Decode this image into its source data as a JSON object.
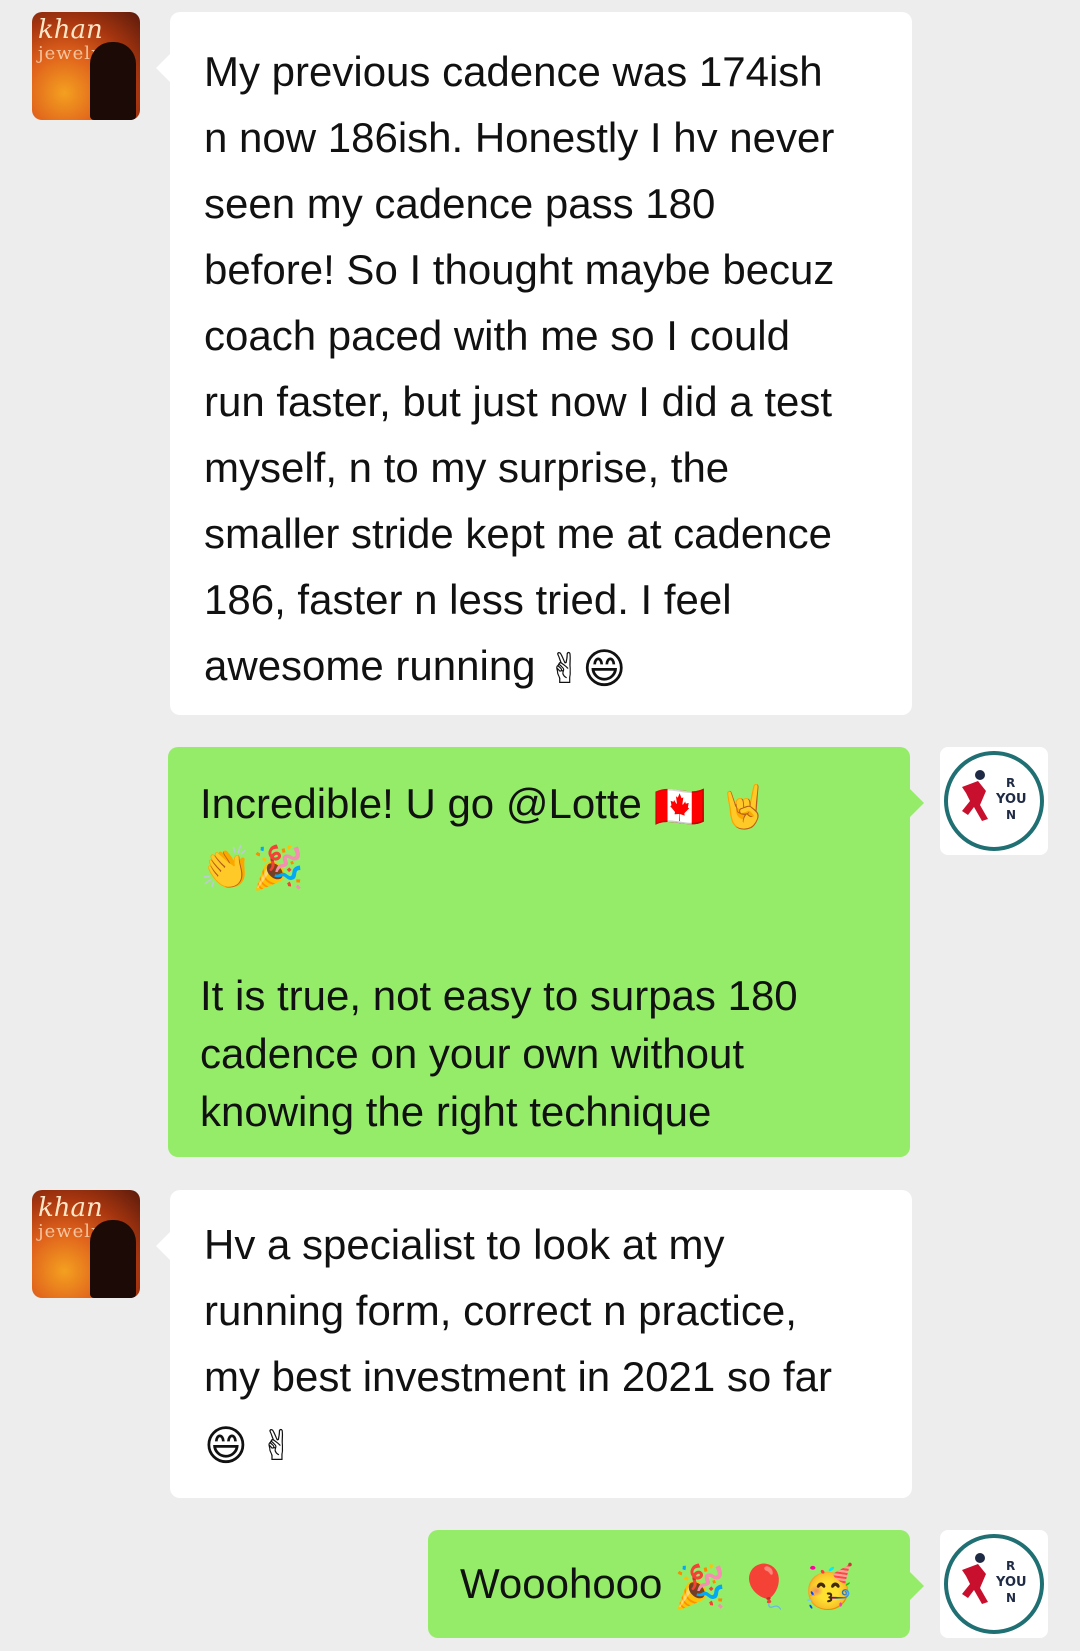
{
  "messages": [
    {
      "sender": "them",
      "avatar": {
        "brand_line1": "khan",
        "brand_line2": "jewelry"
      },
      "lines": [
        "My previous cadence was 174ish",
        "n now 186ish. Honestly I hv never",
        "seen my cadence pass 180",
        "before! So I thought maybe becuz",
        "coach paced with me so I could",
        "run faster, but just now I did a test",
        "myself, n to my surprise, the",
        "smaller stride kept me at cadence",
        "186, faster n less tried. I feel",
        "awesome running"
      ],
      "trailing_emojis": [
        "✌",
        "😄"
      ]
    },
    {
      "sender": "me",
      "avatar": {
        "letters": [
          "R",
          "YOU",
          "N"
        ]
      },
      "line1": "Incredible! U go @Lotte",
      "line1_emojis": [
        "🇨🇦",
        "🤘"
      ],
      "line2_emojis": [
        "👏",
        "🎉"
      ],
      "para2": [
        "It is true, not easy to surpas 180",
        "cadence on your own without",
        "knowing the right technique"
      ]
    },
    {
      "sender": "them",
      "avatar": {
        "brand_line1": "khan",
        "brand_line2": "jewelry"
      },
      "lines": [
        "Hv a specialist to look at my",
        "running form, correct n practice,",
        "my best investment in 2021 so far"
      ],
      "trailing_emojis": [
        "😄",
        "✌"
      ]
    },
    {
      "sender": "me",
      "avatar": {
        "letters": [
          "R",
          "YOU",
          "N"
        ]
      },
      "text": "Wooohooo",
      "emojis": [
        "🎉",
        "🎈",
        "🥳"
      ]
    }
  ],
  "colors": {
    "background": "#ededed",
    "incoming_bubble": "#ffffff",
    "outgoing_bubble": "#95ec69",
    "runner_ring": "#1f6f73",
    "runner_figure": "#c8102e",
    "runner_letters": "#1f2a44"
  }
}
